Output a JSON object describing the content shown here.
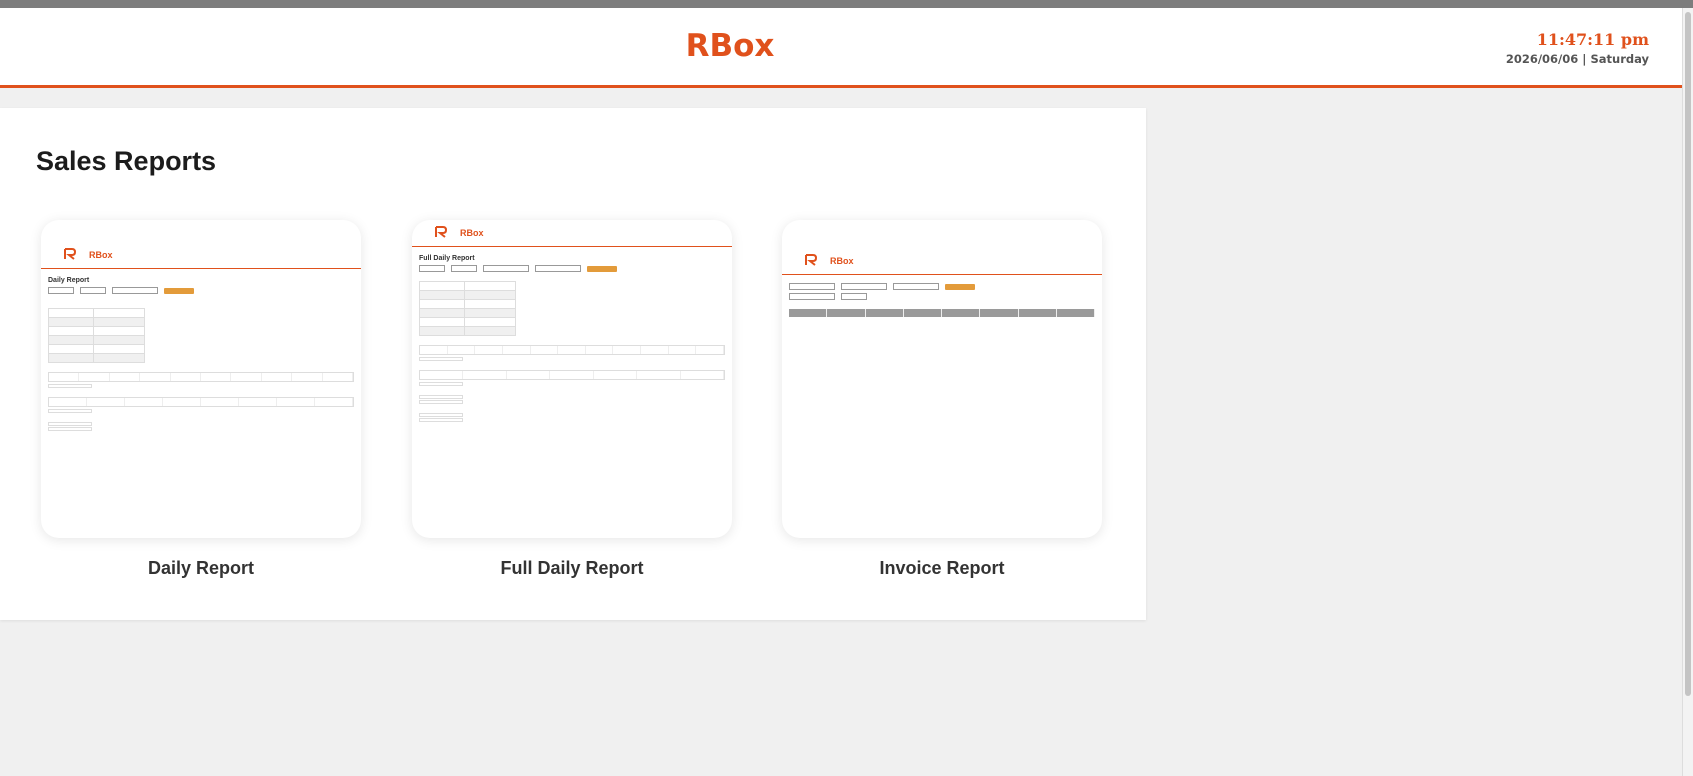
{
  "app": {
    "brand": "RBox"
  },
  "clock": {
    "time": "11:47:11 pm",
    "date": "2026/06/06 | Saturday"
  },
  "page": {
    "title": "Sales Reports"
  },
  "cards": [
    {
      "label": "Daily Report"
    },
    {
      "label": "Full Daily Report"
    },
    {
      "label": "Invoice Report"
    }
  ],
  "colors": {
    "accent": "#e0511c",
    "button": "#e39b3a"
  }
}
